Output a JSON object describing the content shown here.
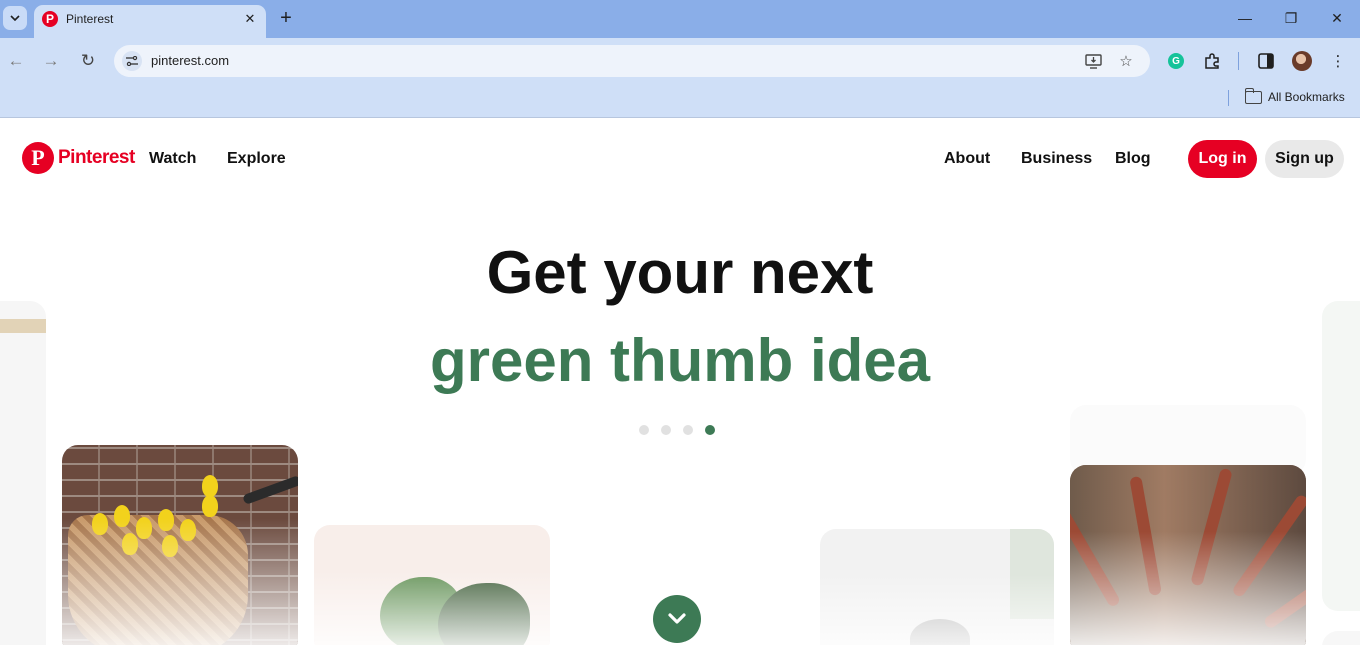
{
  "browser": {
    "tab": {
      "title": "Pinterest",
      "favicon_letter": "P",
      "close": "✕"
    },
    "new_tab": "+",
    "window": {
      "minimize": "—",
      "restore": "❐",
      "close": "✕"
    },
    "nav": {
      "back": "←",
      "forward": "→",
      "reload": "↻"
    },
    "address": {
      "url": "pinterest.com"
    },
    "bookmarks": {
      "all_label": "All Bookmarks"
    }
  },
  "site": {
    "logo_text": "Pinterest",
    "logo_mark": "P",
    "nav_left": [
      "Watch",
      "Explore"
    ],
    "nav_right": [
      "About",
      "Business",
      "Blog"
    ],
    "login_label": "Log in",
    "signup_label": "Sign up"
  },
  "hero": {
    "headline": "Get your next",
    "subheadline": "green thumb idea",
    "carousel": {
      "count": 4,
      "active_index": 3
    }
  },
  "colors": {
    "brand": "#e60023",
    "accent_green": "#3d7a55",
    "chrome_tabstrip": "#8aaee8",
    "chrome_toolbar": "#cfdff7"
  },
  "icons": [
    "tab-search-icon",
    "pinterest-favicon",
    "close-icon",
    "plus-icon",
    "minimize-icon",
    "restore-icon",
    "back-icon",
    "forward-icon",
    "reload-icon",
    "site-info-icon",
    "install-app-icon",
    "star-icon",
    "grammarly-icon",
    "extensions-icon",
    "side-panel-icon",
    "avatar",
    "kebab-menu-icon",
    "folder-icon",
    "chevron-down-icon"
  ]
}
